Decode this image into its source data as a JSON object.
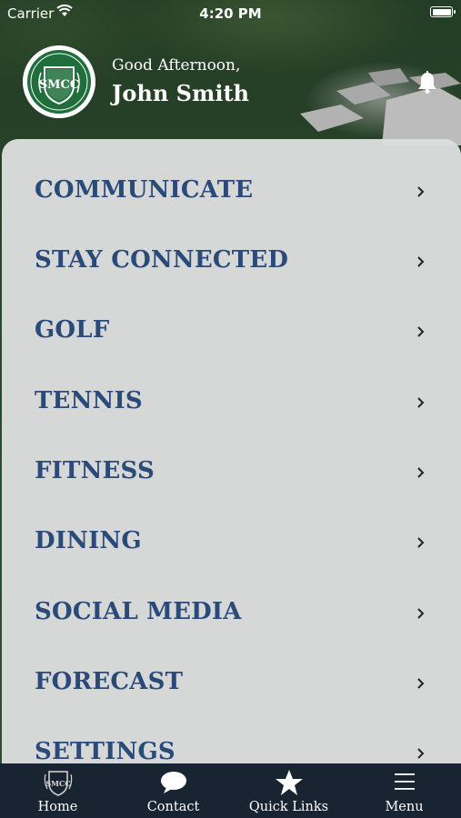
{
  "status_bar": {
    "carrier": "Carrier",
    "time": "4:20 PM"
  },
  "header": {
    "logo_text": "SMCC",
    "greeting": "Good Afternoon,",
    "name": "John Smith"
  },
  "menu": {
    "items": [
      {
        "label": "COMMUNICATE"
      },
      {
        "label": "STAY CONNECTED"
      },
      {
        "label": "GOLF"
      },
      {
        "label": "TENNIS"
      },
      {
        "label": "FITNESS"
      },
      {
        "label": "DINING"
      },
      {
        "label": "SOCIAL MEDIA"
      },
      {
        "label": "FORECAST"
      },
      {
        "label": "SETTINGS"
      }
    ]
  },
  "tabbar": {
    "tabs": [
      {
        "label": "Home",
        "icon": "crest-icon"
      },
      {
        "label": "Contact",
        "icon": "chat-bubble-icon"
      },
      {
        "label": "Quick Links",
        "icon": "star-icon"
      },
      {
        "label": "Menu",
        "icon": "hamburger-icon"
      }
    ]
  },
  "colors": {
    "menu_text": "#2a4a7a",
    "logo_green": "#1f6e3c",
    "tabbar_bg": "#182431",
    "panel_bg": "#dcdddd"
  }
}
